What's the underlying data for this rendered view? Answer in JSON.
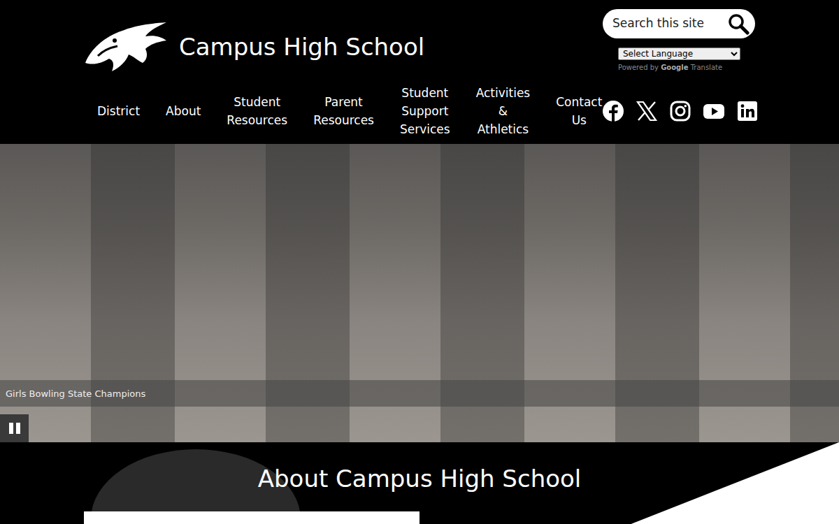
{
  "header": {
    "school_name": "Campus High School"
  },
  "search": {
    "placeholder": "Search this site"
  },
  "translate": {
    "select_label": "Select Language",
    "powered_by": "Powered by",
    "brand": "Google",
    "service": "Translate"
  },
  "nav": {
    "items": [
      "District",
      "About",
      "Student Resources",
      "Parent Resources",
      "Student Support Services",
      "Activities & Athletics",
      "Contact Us"
    ]
  },
  "hero": {
    "caption": "Girls Bowling State Champions",
    "playing": true
  },
  "about": {
    "title": "About Campus High School"
  }
}
